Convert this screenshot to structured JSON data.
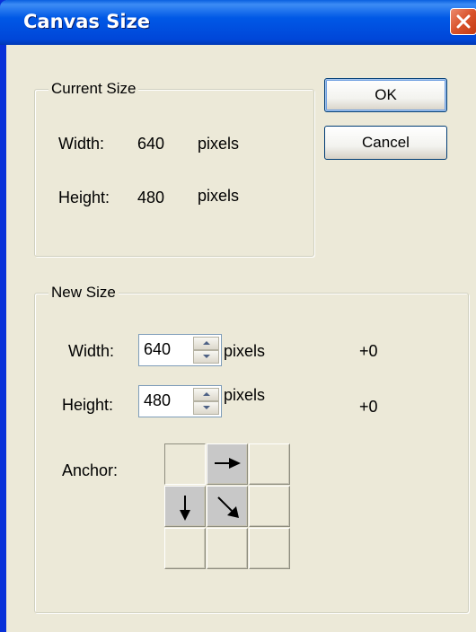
{
  "window": {
    "title": "Canvas Size"
  },
  "buttons": {
    "ok": "OK",
    "cancel": "Cancel"
  },
  "current_size": {
    "legend": "Current Size",
    "width_label": "Width:",
    "width_value": "640",
    "width_unit": "pixels",
    "height_label": "Height:",
    "height_value": "480",
    "height_unit": "pixels"
  },
  "new_size": {
    "legend": "New Size",
    "width_label": "Width:",
    "width_value": "640",
    "width_unit": "pixels",
    "width_delta": "+0",
    "height_label": "Height:",
    "height_value": "480",
    "height_unit": "pixels",
    "height_delta": "+0",
    "anchor_label": "Anchor:"
  },
  "anchor_grid": {
    "selected": "top-left",
    "cells": [
      {
        "pos": "top-left",
        "arrow": "none"
      },
      {
        "pos": "top-center",
        "arrow": "right"
      },
      {
        "pos": "top-right",
        "arrow": "none"
      },
      {
        "pos": "middle-left",
        "arrow": "down"
      },
      {
        "pos": "middle-center",
        "arrow": "down-right"
      },
      {
        "pos": "middle-right",
        "arrow": "none"
      },
      {
        "pos": "bottom-left",
        "arrow": "none"
      },
      {
        "pos": "bottom-center",
        "arrow": "none"
      },
      {
        "pos": "bottom-right",
        "arrow": "none"
      }
    ]
  },
  "colors": {
    "titlebar": "#0046d8",
    "dialog_bg": "#ece9d8",
    "close_button": "#d9532b"
  }
}
